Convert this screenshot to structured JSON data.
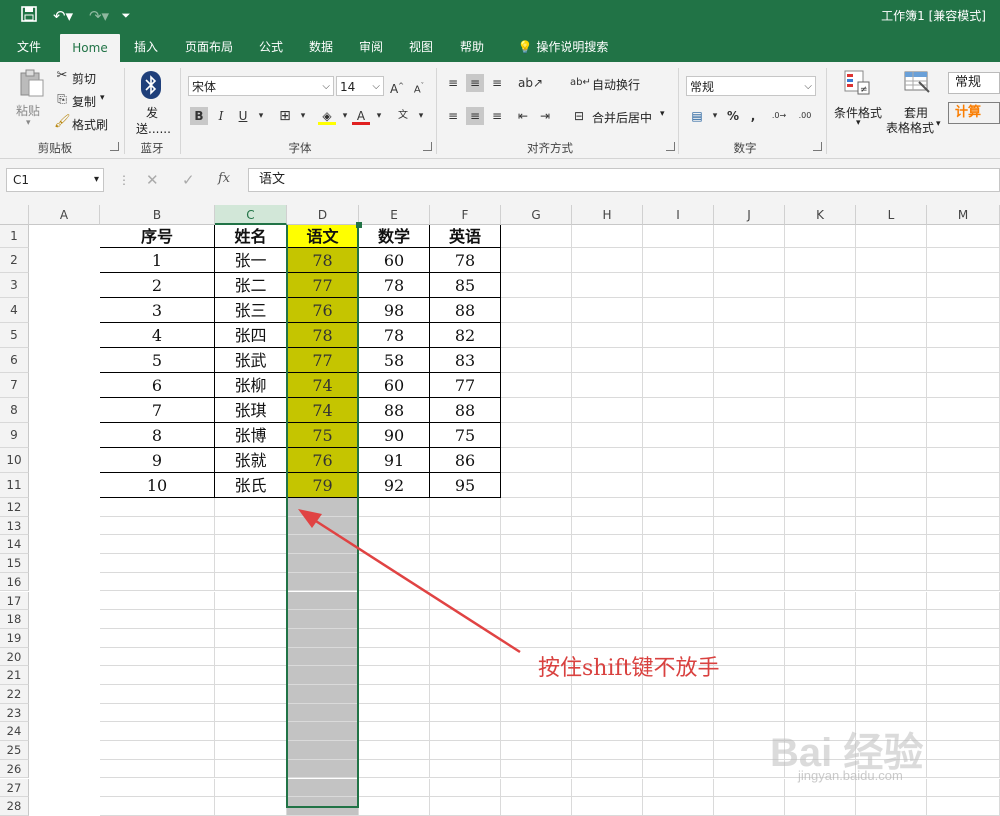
{
  "title_bar": {
    "window_title": "工作簿1  [兼容模式]",
    "quick_access": [
      "save-icon",
      "undo-icon",
      "redo-icon",
      "customize-icon"
    ]
  },
  "tabs": [
    "文件",
    "Home",
    "插入",
    "页面布局",
    "公式",
    "数据",
    "审阅",
    "视图",
    "帮助"
  ],
  "active_tab": "Home",
  "tell_me": "操作说明搜索",
  "ribbon": {
    "clipboard": {
      "paste": "粘贴",
      "cut": "剪切",
      "copy": "复制",
      "format_painter": "格式刷",
      "label": "剪贴板"
    },
    "bluetooth": {
      "send_line1": "发",
      "send_line2": "送......",
      "label": "蓝牙"
    },
    "font": {
      "name": "宋体",
      "size": "14",
      "label": "字体"
    },
    "alignment": {
      "wrap": "自动换行",
      "merge": "合并后居中",
      "label": "对齐方式"
    },
    "number": {
      "format": "常规",
      "label": "数字"
    },
    "styles": {
      "conditional": "条件格式",
      "table_line1": "套用",
      "table_line2": "表格格式",
      "style1": "常规",
      "style2": "计算"
    }
  },
  "formula_bar": {
    "name_box": "C1",
    "content": "语文"
  },
  "columns": [
    "A",
    "B",
    "C",
    "D",
    "E",
    "F",
    "G",
    "H",
    "I",
    "J",
    "K",
    "L",
    "M"
  ],
  "selected_column": "C",
  "row_numbers": [
    "1",
    "2",
    "3",
    "4",
    "5",
    "6",
    "7",
    "8",
    "9",
    "10",
    "11",
    "12",
    "13",
    "14",
    "15",
    "16",
    "17",
    "18",
    "19",
    "20",
    "21",
    "22",
    "23",
    "24",
    "25",
    "26",
    "27",
    "28"
  ],
  "table": {
    "headers": [
      "序号",
      "姓名",
      "语文",
      "数学",
      "英语"
    ],
    "rows": [
      [
        "1",
        "张一",
        "78",
        "60",
        "78"
      ],
      [
        "2",
        "张二",
        "77",
        "78",
        "85"
      ],
      [
        "3",
        "张三",
        "76",
        "98",
        "88"
      ],
      [
        "4",
        "张四",
        "78",
        "78",
        "82"
      ],
      [
        "5",
        "张武",
        "77",
        "58",
        "83"
      ],
      [
        "6",
        "张柳",
        "74",
        "60",
        "77"
      ],
      [
        "7",
        "张琪",
        "74",
        "88",
        "88"
      ],
      [
        "8",
        "张博",
        "75",
        "90",
        "75"
      ],
      [
        "9",
        "张就",
        "76",
        "91",
        "86"
      ],
      [
        "10",
        "张氏",
        "79",
        "92",
        "95"
      ]
    ]
  },
  "annotation": "按住shift键不放手",
  "watermark": "Bai 经验",
  "watermark_url": "jingyan.baidu.com",
  "colors": {
    "excel_green": "#217346",
    "annotation_red": "#d9413f",
    "highlight_yellow": "#ffff00",
    "selected_yellow": "#c5c500"
  }
}
